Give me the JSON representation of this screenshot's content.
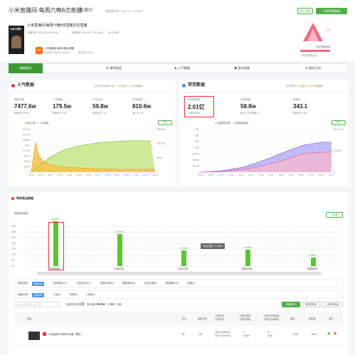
{
  "header": {
    "title": "小米直播间-每周六晚8点直播",
    "type_label": "直播间",
    "update_time": "数据更新时间：2020-06-17 02:45:26",
    "join_btn": "加入监控",
    "mini_btn": "小程序看数据"
  },
  "live": {
    "title": "小米直播间-每周六晚8点直播正在直播",
    "start": "开播时间: 2020-06-16 19:28:51",
    "end": "下播时间: 2020-06-17 02:45:25",
    "duration": "7:16:34分钟",
    "account": "小米直播间-每周六晚8点直播",
    "douyin": "抖音号: xiaomidirexiaomi",
    "fans_count": "粉丝数: 599.8w",
    "cover_text": "小米十周年"
  },
  "portrait": {
    "label": "手机/电脑/配件",
    "sub": "带货直播间运营",
    "female_label": "女性",
    "female_pct": "10%"
  },
  "tabs": [
    {
      "label": "数据概览",
      "icon": "chart-icon"
    },
    {
      "label": "带货商品",
      "icon": "cart-icon"
    },
    {
      "label": "人气数据",
      "icon": "people-icon"
    },
    {
      "label": "观众画像",
      "icon": "user-icon"
    },
    {
      "label": "观众互动",
      "icon": "chat-icon"
    }
  ],
  "popularity": {
    "title": "人气数据",
    "note_prefix": "平均每分钟观看人数",
    "note_value": "17,160",
    "note_mid": "超过",
    "note_pct": "93.53%",
    "note_suffix": "的直播间",
    "stats": [
      {
        "label": "观看人数",
        "value": "7477.6w",
        "sub": "转粉率 328.8w"
      },
      {
        "label": "人气峰值",
        "value": "179.5w",
        "sub": "转粉率 4.34%"
      },
      {
        "label": "平均在线",
        "value": "59.8w",
        "sub": "停留时长 1:32"
      },
      {
        "label": "本场音浪",
        "value": "810.6w",
        "sub": "收入 81.1w"
      }
    ],
    "legend": [
      "在线人数",
      "人气峰值"
    ],
    "export": "导出"
  },
  "sales": {
    "title": "带货数据",
    "note_prefix": "带货总额",
    "note_value": "2.01亿",
    "note_mid": "超过",
    "note_pct": "99.99%",
    "note_suffix": "的直播间",
    "stats": [
      {
        "label": "本场销售额",
        "value": "2.01亿",
        "sub": "上架商品 60"
      },
      {
        "label": "本场销量",
        "value": "58.8w",
        "sub": "用户人均订单数 2.7"
      },
      {
        "label": "客单价",
        "value": "343.1",
        "sub": "转化率 0.78%"
      }
    ],
    "legend": [
      "全网销售总额",
      "全网销量增量"
    ],
    "export": "导出"
  },
  "chart_left": {
    "x_ticks": [
      "19:33",
      "20:05",
      "20:37",
      "21:09",
      "21:41",
      "22:13",
      "22:45",
      "23:17",
      "23:49",
      "00:21",
      "00:53",
      "01:25",
      "01:57",
      "02:27"
    ],
    "y_left": [
      "214.4w",
      "187.6w",
      "160.8w",
      "134w",
      "107.2w",
      "80.4w",
      "53.6w",
      "26.8w",
      "0"
    ],
    "y_right": [
      "8890.5w",
      "7923.2w",
      "5.46%",
      "0"
    ]
  },
  "chart_right": {
    "x_ticks": [
      "19:33",
      "20:05",
      "20:37",
      "21:09",
      "21:41",
      "22:13",
      "22:45",
      "23:17",
      "23:49",
      "00:21",
      "00:53",
      "01:25",
      "01:57",
      "02:27"
    ],
    "y_left": [
      "2.1亿",
      "1.8亿",
      "1.5亿",
      "1.2亿",
      "9000w",
      "6000w",
      "3000w",
      "0"
    ],
    "y_right": [
      "24071.1w",
      "1974.9w",
      "0"
    ]
  },
  "goods_section": {
    "title": "带货商品数据",
    "sub": "热销商品品类",
    "sub2": "大品类"
  },
  "chart_data": {
    "type": "bar",
    "categories": [
      "手机数码",
      "日用百货",
      "礼品文具",
      "居家日用",
      "智能家电"
    ],
    "values": [
      39.66,
      28.33,
      13.56,
      14.59,
      7.46
    ],
    "labels": [
      "39.66%",
      "28.33%",
      "13.56%",
      "14.59%",
      "7.46%"
    ],
    "y_ticks": [
      "35%",
      "30%",
      "25%",
      "20%",
      "15%",
      "10%",
      "5%",
      "0%"
    ],
    "ylim": [
      0,
      35
    ],
    "tooltip": "礼品文具: 13.56%"
  },
  "filters": {
    "row1_label": "商品品类",
    "row1": [
      "全部(60)",
      "手机数码(27)",
      "日用百货(17)",
      "居家日用(8)",
      "智能家电(5)",
      "礼品文具(6)",
      "智能硬件(4)",
      "电脑(1)"
    ],
    "row2_label": "佣金比例",
    "row2": [
      "全部(60)",
      "小米(4)",
      "米家(3)",
      "米兔(3)"
    ],
    "stats_text1": "总销售额",
    "stats_val1": "2.01亿",
    "stats_text2": "累计销量",
    "stats_val2": "58.8w",
    "stats_text3": "共",
    "stats_val3": "60",
    "stats_text4": "个商品",
    "search_placeholder": "请输入商品名称、或 \"口红\"",
    "sort_btns": [
      "销量排序",
      "销售额排序",
      "上架时间排序"
    ]
  },
  "table": {
    "headers": [
      "商品",
      "售价",
      "佣金比例",
      "上架时间\n下架时间",
      "上架时销量\n下架时销量",
      "上架时全网销量\n下架时全网销量",
      "销量",
      "销售额",
      "操作"
    ],
    "rows": [
      {
        "name": "小米巨能写中性笔10支装（黑色）",
        "price": "¥1",
        "commission": "¥1",
        "time1": "06-16 20:58:27",
        "time2": "06-17 02:45:25",
        "s1": "0",
        "s2": "10.6w",
        "w1": "11",
        "w2": "8.0w",
        "sales": "8.0w",
        "amount": "8.0w"
      }
    ]
  }
}
